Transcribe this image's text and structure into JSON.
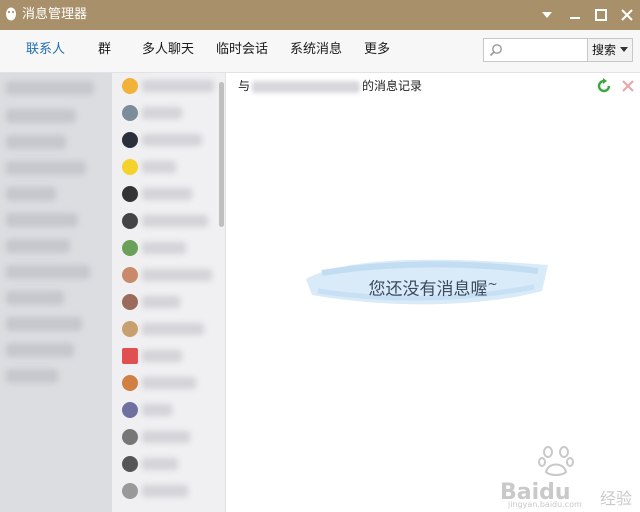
{
  "window": {
    "title": "消息管理器"
  },
  "toolbar": {
    "tabs": [
      {
        "label": "联系人",
        "active": true
      },
      {
        "label": "群",
        "active": false
      },
      {
        "label": "多人聊天",
        "active": false
      },
      {
        "label": "临时会话",
        "active": false
      },
      {
        "label": "系统消息",
        "active": false
      },
      {
        "label": "更多",
        "active": false
      }
    ],
    "search": {
      "placeholder": "",
      "button_label": "搜索"
    }
  },
  "main": {
    "header_prefix": "与",
    "header_suffix": "的消息记录",
    "empty_message": "您还没有消息喔",
    "empty_tilde": "~"
  },
  "contacts": {
    "avatar_colors": [
      "#f2b23a",
      "#7b8c9a",
      "#2a2f3a",
      "#f4d22a",
      "#333333",
      "#444444",
      "#6aa05a",
      "#c88a6a",
      "#9a6a5a",
      "#c8a070",
      "#e05050",
      "#d08040",
      "#7070a0",
      "#777777",
      "#555555",
      "#999999"
    ]
  },
  "colors": {
    "titlebar": "#a8916a",
    "accent": "#1f6fb3",
    "left_panel": "#dcdde1",
    "contacts_panel": "#f0f0f2"
  },
  "watermark": {
    "brand": "Baidu",
    "suffix": "经验",
    "url": "jingyan.baidu.com"
  }
}
